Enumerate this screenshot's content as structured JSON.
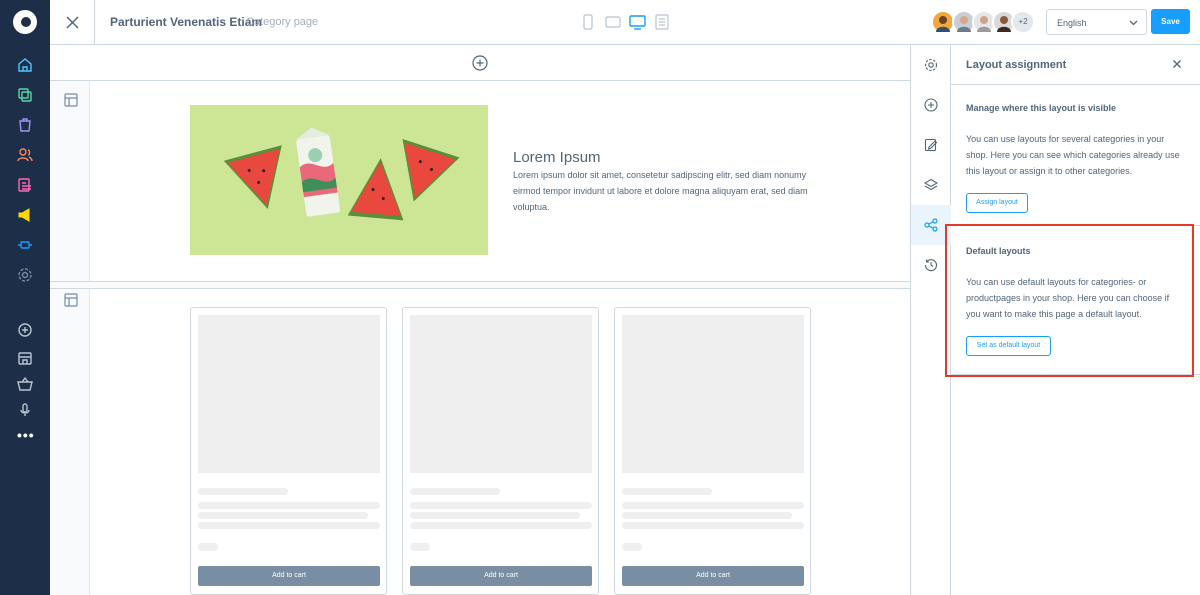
{
  "header": {
    "title": "Parturient Venenatis Etiam",
    "subtitle": "Category page",
    "collaborators_more": "+2",
    "language": "English",
    "save_label": "Save"
  },
  "hero": {
    "heading": "Lorem Ipsum",
    "text": "Lorem ipsum dolor sit amet, consetetur sadipscing elitr, sed diam nonumy eirmod tempor invidunt ut labore et dolore magna aliquyam erat, sed diam voluptua."
  },
  "products": [
    {
      "button": "Add to cart"
    },
    {
      "button": "Add to cart"
    },
    {
      "button": "Add to cart"
    }
  ],
  "panel": {
    "title": "Layout assignment",
    "visibility": {
      "title": "Manage where this layout is visible",
      "text": "You can use layouts for several categories in your shop. Here you can see which categories already use this layout or assign it to other categories.",
      "button": "Assign layout"
    },
    "defaults": {
      "title": "Default layouts",
      "text": "You can use default layouts for categories- or productpages in your shop. Here you can choose if you want to make this page a default layout.",
      "button": "Set as default layout"
    }
  },
  "colors": {
    "sidebar_bg": "#1c2e48",
    "accent": "#189eff",
    "highlight": "#e23b2e",
    "button_gray": "#7a8ea3"
  },
  "icons": {
    "sidebar": [
      "dashboard-icon",
      "catalogue-icon",
      "orders-icon",
      "customers-icon",
      "content-icon",
      "marketing-icon",
      "extensions-icon",
      "settings-icon",
      "add-icon",
      "sales-channel-icon",
      "basket-icon",
      "headless-icon",
      "more-icon"
    ],
    "tabs": [
      "settings-icon",
      "add-block-icon",
      "edit-icon",
      "layers-icon",
      "share-icon",
      "history-icon"
    ],
    "devices": [
      "mobile-icon",
      "tablet-icon",
      "desktop-icon",
      "form-icon"
    ]
  }
}
